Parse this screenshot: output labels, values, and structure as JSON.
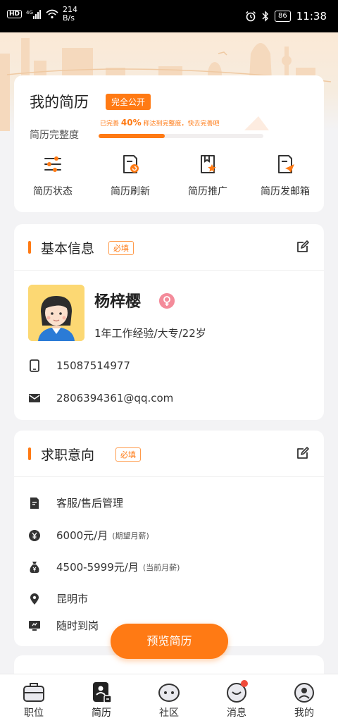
{
  "status_bar": {
    "hd": "HD",
    "net_speed_value": "214",
    "net_speed_unit": "B/s",
    "battery": "86",
    "time": "11:38"
  },
  "resume": {
    "title": "我的简历",
    "visibility_badge": "完全公开",
    "completeness_label": "简历完整度",
    "progress_tip_prefix": "已完善",
    "progress_tip_percent": "40%",
    "progress_tip_suffix": "称达到完整度，快去完善吧",
    "progress_value": 0.4,
    "actions": [
      {
        "label": "简历状态",
        "icon": "sliders-icon"
      },
      {
        "label": "简历刷新",
        "icon": "refresh-document-icon"
      },
      {
        "label": "简历推广",
        "icon": "promote-document-icon"
      },
      {
        "label": "简历发邮箱",
        "icon": "send-document-icon"
      }
    ]
  },
  "basic_info": {
    "title": "基本信息",
    "required_badge": "必填",
    "name": "杨梓樱",
    "summary": "1年工作经验/大专/22岁",
    "phone": "15087514977",
    "email": "2806394361@qq.com"
  },
  "job_intent": {
    "title": "求职意向",
    "required_badge": "必填",
    "position": "客服/售后管理",
    "expected_salary": "6000元/月",
    "expected_salary_note": "(期望月薪)",
    "current_salary": "4500-5999元/月",
    "current_salary_note": "(当前月薪)",
    "city": "昆明市",
    "availability": "随时到岗"
  },
  "preview_button": "预览简历",
  "tab_bar": {
    "tabs": [
      {
        "label": "职位",
        "icon": "briefcase-icon"
      },
      {
        "label": "简历",
        "icon": "resume-icon"
      },
      {
        "label": "社区",
        "icon": "chat-bubbles-icon"
      },
      {
        "label": "消息",
        "icon": "message-icon"
      },
      {
        "label": "我的",
        "icon": "profile-icon"
      }
    ],
    "active_index": 1
  },
  "colors": {
    "accent": "#ff7a14",
    "badge_pink": "#f48b9a",
    "notification_red": "#f04b3a"
  }
}
